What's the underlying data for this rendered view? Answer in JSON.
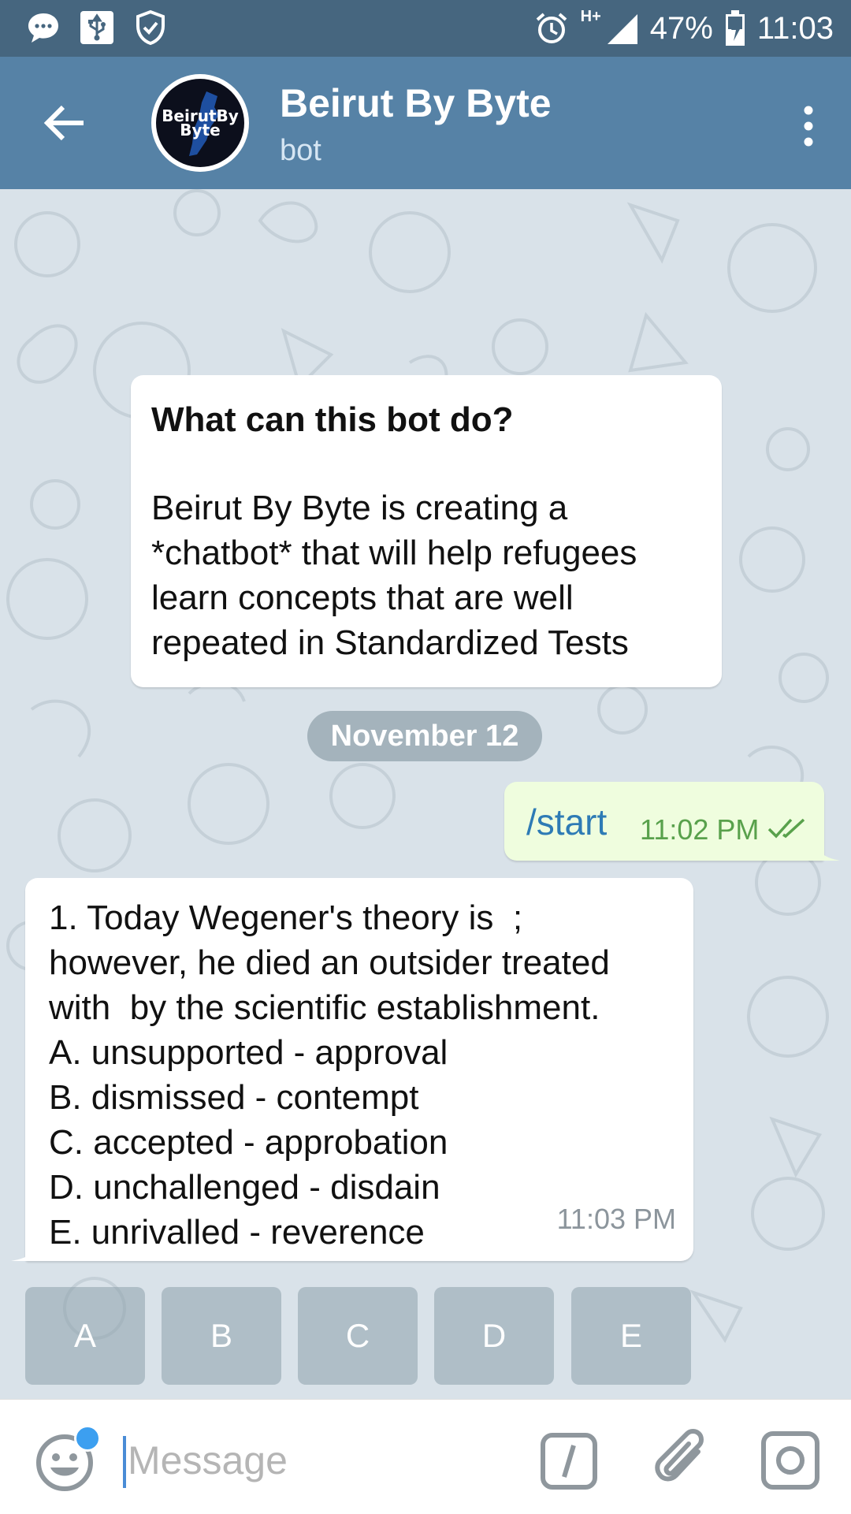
{
  "status_bar": {
    "network": "H+",
    "battery": "47%",
    "time": "11:03"
  },
  "header": {
    "title": "Beirut By Byte",
    "subtitle": "bot",
    "avatar_text_line1": "BeirutBy",
    "avatar_text_line2": "Byte"
  },
  "info_card": {
    "title": "What can this bot do?",
    "body": "Beirut By Byte is creating a *chatbot* that will help refugees learn concepts that are well repeated in Standardized Tests"
  },
  "date_separator": "November 12",
  "outgoing": {
    "text": "/start",
    "time": "11:02 PM"
  },
  "incoming": {
    "lines": [
      "1. Today Wegener's theory is  ;",
      "however, he died an outsider treated",
      "with  by the scientific establishment.",
      "A. unsupported - approval",
      "B. dismissed - contempt",
      "C. accepted - approbation",
      "D. unchallenged - disdain",
      "E. unrivalled - reverence"
    ],
    "time": "11:03 PM"
  },
  "reply_keyboard": [
    "A",
    "B",
    "C",
    "D",
    "E"
  ],
  "input_bar": {
    "placeholder": "Message"
  },
  "colors": {
    "status_bar": "#46667f",
    "app_bar": "#5682a6",
    "chat_background": "#d9e2e9",
    "outgoing_bubble": "#effdde",
    "accent": "#3c9ff0"
  }
}
